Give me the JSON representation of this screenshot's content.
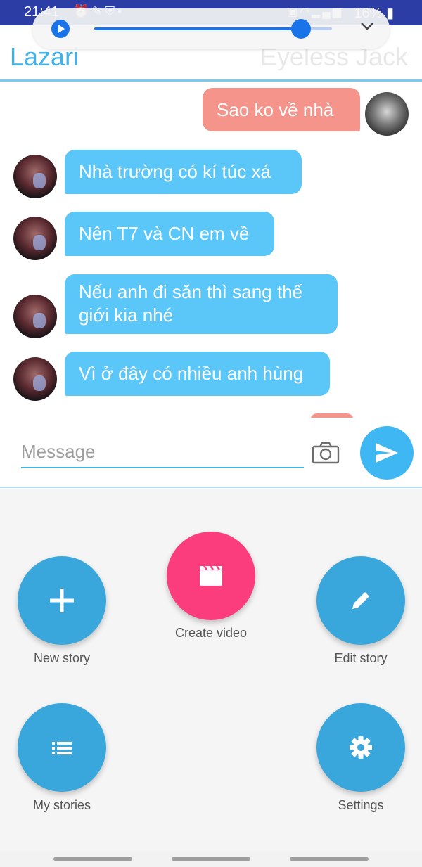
{
  "status_bar": {
    "time": "21:41",
    "battery": "16%",
    "left_icons": [
      "alarm-icon",
      "broom-icon",
      "shield-icon",
      "dot-icon"
    ],
    "right_icons": [
      "battery-saver-icon",
      "wifi-icon",
      "signal-icon",
      "signal-icon",
      "battery-icon"
    ]
  },
  "media_player": {
    "progress": 0.87,
    "icons": [
      "play-icon",
      "chevron-down-icon"
    ],
    "accent": "#1a73e8"
  },
  "header": {
    "left_name": "Lazari",
    "right_name": "Eyeless Jack",
    "accent": "#3fb2e9"
  },
  "messages": [
    {
      "side": "out",
      "text": "Sao ko về nhà"
    },
    {
      "side": "in",
      "text": "Nhà trường có kí túc xá"
    },
    {
      "side": "in",
      "text": "Nên T7 và CN em về"
    },
    {
      "side": "in",
      "text": "Nếu anh đi săn thì sang thế giới kia nhé"
    },
    {
      "side": "in",
      "text": "Vì ở đây có nhiều anh hùng"
    }
  ],
  "bubble_colors": {
    "in": "#5bc6f8",
    "out": "#f4948a"
  },
  "composer": {
    "placeholder": "Message",
    "icons": [
      "camera-icon",
      "send-icon"
    ]
  },
  "actions": {
    "create_video": "Create video",
    "new_story": "New story",
    "edit_story": "Edit story",
    "my_stories": "My stories",
    "settings": "Settings",
    "colors": {
      "blue": "#3aa7dc",
      "pink": "#fb3d7d"
    }
  }
}
